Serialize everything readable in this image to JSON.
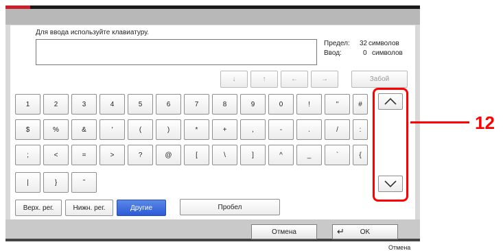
{
  "instruction": "Для ввода используйте клавиатуру.",
  "limit": {
    "label": "Предел:",
    "value": "32",
    "unit": "символов"
  },
  "input_count": {
    "label": "Ввод:",
    "value": "0",
    "unit": "символов"
  },
  "nav": {
    "down": "↓",
    "up": "↑",
    "left": "←",
    "right": "→",
    "backspace": "Забой"
  },
  "keys": {
    "row1": [
      "1",
      "2",
      "3",
      "4",
      "5",
      "6",
      "7",
      "8",
      "9",
      "0",
      "!",
      "\"",
      "#"
    ],
    "row2": [
      "$",
      "%",
      "&",
      "′",
      "(",
      ")",
      "*",
      "+",
      ",",
      "-",
      ".",
      "/",
      ":"
    ],
    "row3": [
      ";",
      "<",
      "=",
      ">",
      "?",
      "@",
      "[",
      "\\",
      "]",
      "^",
      "_",
      "`",
      "{"
    ],
    "row4": [
      "|",
      "}",
      "˜"
    ]
  },
  "modes": {
    "upper": "Верх. рег.",
    "lower": "Нижн. рег.",
    "other": "Другие",
    "space": "Пробел"
  },
  "actions": {
    "cancel": "Отмена",
    "ok": "OK"
  },
  "callout_number": "12",
  "footer_cut": "Отмена"
}
